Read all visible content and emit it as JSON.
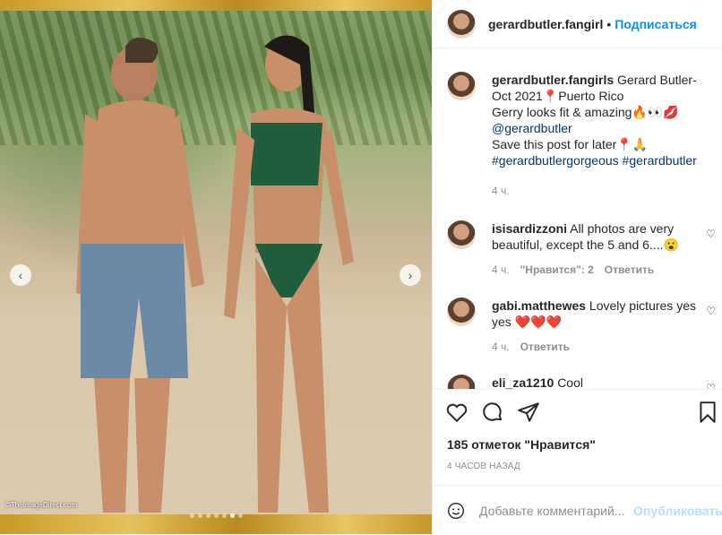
{
  "photo": {
    "credit": "©TheImageDirect.com",
    "slide_count": 7,
    "active_slide": 6
  },
  "header": {
    "username": "gerardbutler.fangirl",
    "separator": "•",
    "follow_label": "Подписаться"
  },
  "caption": {
    "username": "gerardbutler.fangirls",
    "line1": "Gerard Butler-Oct 2021📍Puerto Rico",
    "line2": "Gerry looks fit & amazing🔥👀💋",
    "mention": "@gerardbutler",
    "line3": "Save this post for later📍🙏",
    "hashtags": "#gerardbutlergorgeous #gerardbutler",
    "time": "4 ч."
  },
  "comments": [
    {
      "username": "isisardizzoni",
      "text": "All photos are very beautiful, except the 5 and 6....😮",
      "time": "4 ч.",
      "likes": "\"Нравится\": 2",
      "reply": "Ответить"
    },
    {
      "username": "gabi.matthewes",
      "text": "Lovely pictures yes yes ❤️❤️❤️",
      "time": "4 ч.",
      "reply": "Ответить"
    },
    {
      "username": "eli_za1210",
      "text": "Cool"
    }
  ],
  "likes": "185 отметок \"Нравится\"",
  "posted": "4 ЧАСОВ НАЗАД",
  "comment_box": {
    "placeholder": "Добавьте комментарий...",
    "publish_label": "Опубликовать"
  },
  "colors": {
    "accent": "#0095f6",
    "muted": "#8e8e8e"
  }
}
